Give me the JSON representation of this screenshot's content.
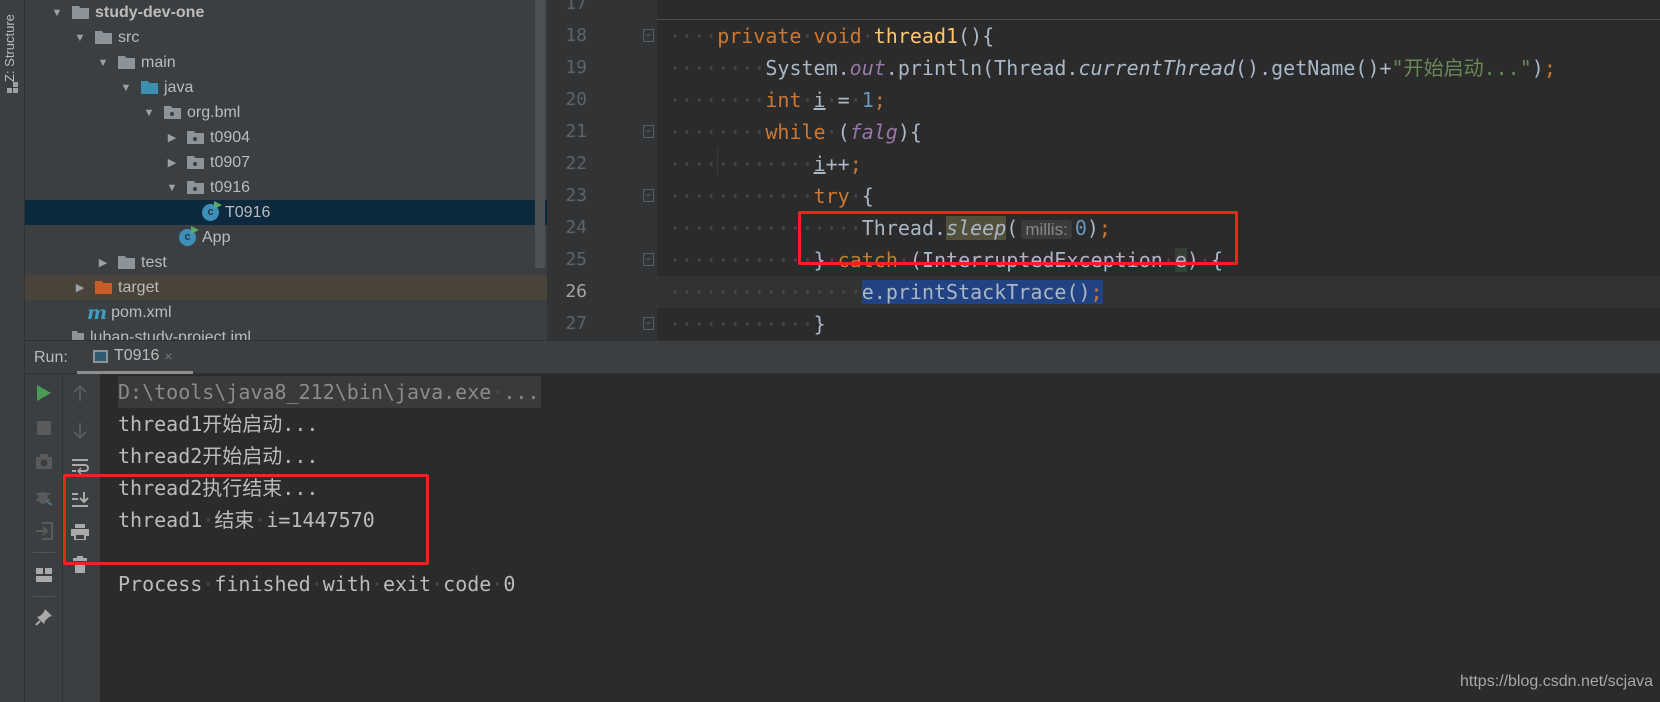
{
  "left_stripe": {
    "label": "Z: Structure"
  },
  "project_tree": {
    "items": [
      {
        "label": "study-dev-one",
        "level": 0,
        "arrow": "expanded",
        "icon": "module-folder-icon",
        "bold": true
      },
      {
        "label": "src",
        "level": 1,
        "arrow": "expanded",
        "icon": "folder-icon"
      },
      {
        "label": "main",
        "level": 2,
        "arrow": "expanded",
        "icon": "folder-icon"
      },
      {
        "label": "java",
        "level": 3,
        "arrow": "expanded",
        "icon": "source-folder-icon"
      },
      {
        "label": "org.bml",
        "level": 4,
        "arrow": "expanded",
        "icon": "package-icon"
      },
      {
        "label": "t0904",
        "level": 5,
        "arrow": "collapsed",
        "icon": "package-icon"
      },
      {
        "label": "t0907",
        "level": 5,
        "arrow": "collapsed",
        "icon": "package-icon"
      },
      {
        "label": "t0916",
        "level": 5,
        "arrow": "expanded",
        "icon": "package-icon"
      },
      {
        "label": "T0916",
        "level": 6,
        "arrow": "none",
        "icon": "java-class-icon",
        "selected": true
      },
      {
        "label": "App",
        "level": 5,
        "arrow": "none",
        "icon": "java-class-icon"
      },
      {
        "label": "test",
        "level": 2,
        "arrow": "collapsed",
        "icon": "folder-icon"
      },
      {
        "label": "target",
        "level": 1,
        "arrow": "collapsed",
        "icon": "excluded-folder-icon",
        "excluded": true
      },
      {
        "label": "pom.xml",
        "level": 1,
        "arrow": "none",
        "icon": "maven-icon"
      },
      {
        "label": "luban-study-project.iml",
        "level": 0,
        "arrow": "none",
        "icon": "iml-file-icon"
      }
    ]
  },
  "editor": {
    "current_line": 26,
    "lines": [
      {
        "n": "17",
        "tokens": []
      },
      {
        "n": "18",
        "fold": "open",
        "tokens": [
          {
            "t": "    "
          },
          {
            "t": "private",
            "c": "kw"
          },
          {
            "t": " "
          },
          {
            "t": "void",
            "c": "kw"
          },
          {
            "t": " "
          },
          {
            "t": "thread1",
            "c": "fn"
          },
          {
            "t": "(){"
          }
        ]
      },
      {
        "n": "19",
        "tokens": [
          {
            "t": "        System."
          },
          {
            "t": "out",
            "c": "static"
          },
          {
            "t": ".println(Thread."
          },
          {
            "t": "currentThread",
            "c": "it"
          },
          {
            "t": "().getName()+"
          },
          {
            "t": "\"开始启动...\"",
            "c": "str"
          },
          {
            "t": ")"
          },
          {
            "t": ";",
            "c": "kw"
          }
        ]
      },
      {
        "n": "20",
        "tokens": [
          {
            "t": "        "
          },
          {
            "t": "int",
            "c": "kw"
          },
          {
            "t": " "
          },
          {
            "t": "i",
            "c": "ul"
          },
          {
            "t": " = "
          },
          {
            "t": "1",
            "c": "num"
          },
          {
            "t": ";",
            "c": "kw"
          }
        ]
      },
      {
        "n": "21",
        "fold": "open",
        "tokens": [
          {
            "t": "        "
          },
          {
            "t": "while",
            "c": "kw"
          },
          {
            "t": " ("
          },
          {
            "t": "falg",
            "c": "static"
          },
          {
            "t": "){"
          }
        ]
      },
      {
        "n": "22",
        "tokens": [
          {
            "t": "            "
          },
          {
            "t": "i",
            "c": "ul"
          },
          {
            "t": "++"
          },
          {
            "t": ";",
            "c": "kw"
          }
        ]
      },
      {
        "n": "23",
        "fold": "open",
        "tokens": [
          {
            "t": "            "
          },
          {
            "t": "try",
            "c": "kw"
          },
          {
            "t": " {"
          }
        ]
      },
      {
        "n": "24",
        "tokens": [
          {
            "t": "                Thread."
          },
          {
            "t": "sleep",
            "c": "it hl-sleep"
          },
          {
            "t": "("
          },
          {
            "t": "millis:",
            "c": "hint"
          },
          {
            "t": "0",
            "c": "num"
          },
          {
            "t": ")"
          },
          {
            "t": ";",
            "c": "kw"
          }
        ]
      },
      {
        "n": "25",
        "fold": "close",
        "tokens": [
          {
            "t": "            } "
          },
          {
            "t": "catch",
            "c": "kw"
          },
          {
            "t": " (InterruptedException "
          },
          {
            "t": "e",
            "c": "hl-e"
          },
          {
            "t": ") {"
          }
        ]
      },
      {
        "n": "26",
        "tokens": [
          {
            "t": "                "
          },
          {
            "t": "e.printStackTrace()",
            "c": "sel"
          },
          {
            "t": ";",
            "c": "kw sel"
          }
        ]
      },
      {
        "n": "27",
        "fold": "close",
        "tokens": [
          {
            "t": "            }"
          }
        ]
      }
    ]
  },
  "run_panel": {
    "label": "Run:",
    "tab": {
      "label": "T0916",
      "close": "×"
    },
    "toolbar_left": [
      "run-icon",
      "stop-icon",
      "camera-icon",
      "debug-icon",
      "login-icon",
      "layout-icon",
      "pin-icon"
    ],
    "toolbar_right": [
      "up-arrow-icon",
      "down-arrow-icon",
      "soft-wrap-icon",
      "scroll-to-end-icon",
      "print-icon",
      "trash-icon"
    ],
    "console": [
      {
        "text": "D:\\tools\\java8_212\\bin\\java.exe ...",
        "kind": "cmd"
      },
      {
        "text": "thread1开始启动..."
      },
      {
        "text": "thread2开始启动..."
      },
      {
        "text": "thread2执行结束..."
      },
      {
        "text": "thread1 结束 i=1447570"
      },
      {
        "text": ""
      },
      {
        "text": "Process finished with exit code 0"
      }
    ]
  },
  "colors": {
    "annotation_box": "#f2231c",
    "keyword": "#cc7832",
    "selection": "#214283"
  },
  "watermark": "https://blog.csdn.net/scjava"
}
